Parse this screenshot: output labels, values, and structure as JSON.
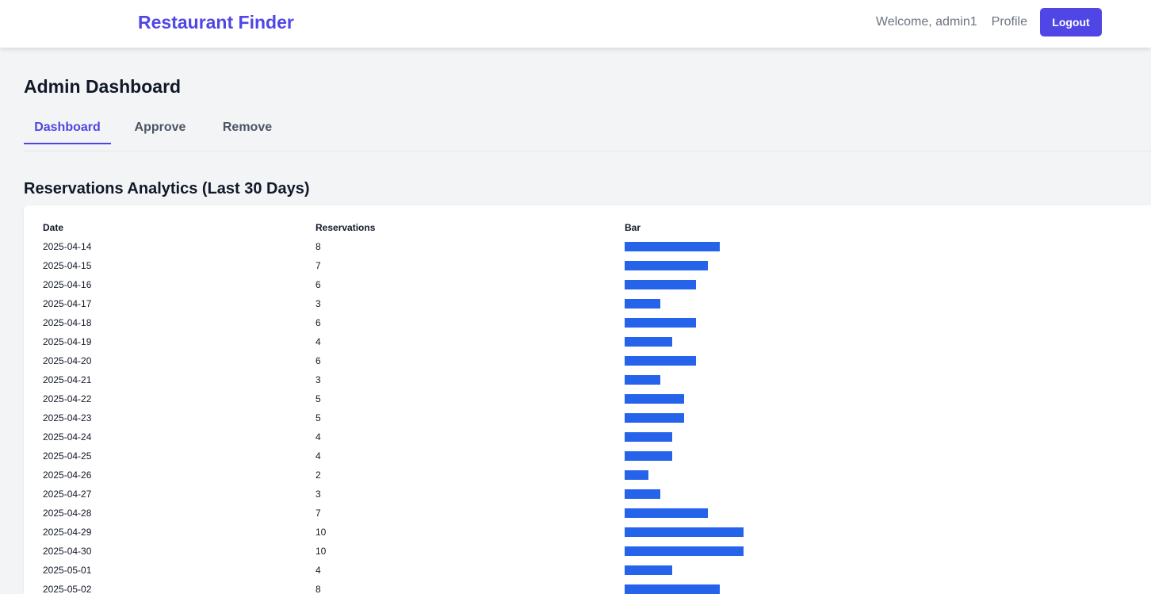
{
  "navbar": {
    "brand": "Restaurant Finder",
    "welcome": "Welcome, admin1",
    "profile_label": "Profile",
    "logout_label": "Logout"
  },
  "page": {
    "title": "Admin Dashboard"
  },
  "tabs": [
    {
      "label": "Dashboard",
      "active": true
    },
    {
      "label": "Approve",
      "active": false
    },
    {
      "label": "Remove",
      "active": false
    }
  ],
  "analytics": {
    "title": "Reservations Analytics (Last 30 Days)",
    "columns": [
      "Date",
      "Reservations",
      "Bar"
    ],
    "bar_color": "#2563eb",
    "accent_color": "#4f46e5"
  },
  "chart_data": {
    "type": "bar",
    "categories": [
      "2025-04-14",
      "2025-04-15",
      "2025-04-16",
      "2025-04-17",
      "2025-04-18",
      "2025-04-19",
      "2025-04-20",
      "2025-04-21",
      "2025-04-22",
      "2025-04-23",
      "2025-04-24",
      "2025-04-25",
      "2025-04-26",
      "2025-04-27",
      "2025-04-28",
      "2025-04-29",
      "2025-04-30",
      "2025-05-01",
      "2025-05-02"
    ],
    "values": [
      8,
      7,
      6,
      3,
      6,
      4,
      6,
      3,
      5,
      5,
      4,
      4,
      2,
      3,
      7,
      10,
      10,
      4,
      8
    ],
    "orientation": "horizontal",
    "xlabel": "Bar",
    "ylabel": "Date"
  }
}
